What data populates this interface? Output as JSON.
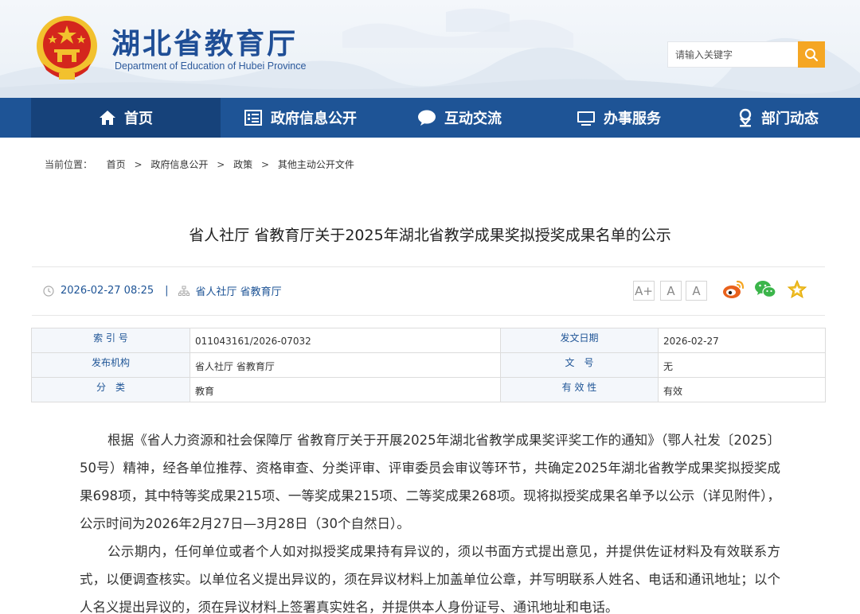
{
  "header": {
    "site_title": "湖北省教育厅",
    "site_subtitle": "Department of Education of Hubei Province",
    "search_placeholder": "请输入关键字"
  },
  "nav": {
    "items": [
      {
        "label": "首页",
        "icon": "home-icon"
      },
      {
        "label": "政府信息公开",
        "icon": "document-list-icon"
      },
      {
        "label": "互动交流",
        "icon": "chat-bubble-icon"
      },
      {
        "label": "办事服务",
        "icon": "monitor-icon"
      },
      {
        "label": "部门动态",
        "icon": "person-pin-icon"
      }
    ]
  },
  "breadcrumb": {
    "prefix": "当前位置：",
    "items": [
      "首页",
      "政府信息公开",
      "政策",
      "其他主动公开文件"
    ],
    "separator": ">"
  },
  "article": {
    "title": "省人社厅 省教育厅关于2025年湖北省教学成果奖拟授奖成果名单的公示",
    "datetime": "2026-02-27 08:25",
    "divider": "|",
    "source": "省人社厅 省教育厅",
    "font_buttons": [
      "A+",
      "A",
      "A"
    ],
    "share_icons": [
      "weibo-icon",
      "wechat-icon",
      "favorite-star-icon"
    ]
  },
  "info_table": {
    "rows": [
      {
        "label1": "索 引 号",
        "value1": "011043161/2026-07032",
        "label2": "发文日期",
        "value2": "2026-02-27"
      },
      {
        "label1": "发布机构",
        "value1": "省人社厅 省教育厅",
        "label2": "文　号",
        "value2": "无"
      },
      {
        "label1": "分　类",
        "value1": "教育",
        "label2": "有 效 性",
        "value2": "有效"
      }
    ]
  },
  "body": {
    "paragraphs": [
      "根据《省人力资源和社会保障厅 省教育厅关于开展2025年湖北省教学成果奖评奖工作的通知》（鄂人社发〔2025〕50号）精神，经各单位推荐、资格审查、分类评审、评审委员会审议等环节，共确定2025年湖北省教学成果奖拟授奖成果698项，其中特等奖成果215项、一等奖成果215项、二等奖成果268项。现将拟授奖成果名单予以公示（详见附件），公示时间为2026年2月27日—3月28日（30个自然日）。",
      "公示期内，任何单位或者个人如对拟授奖成果持有异议的，须以书面方式提出意见，并提供佐证材料及有效联系方式，以便调查核实。以单位名义提出异议的，须在异议材料上加盖单位公章，并写明联系人姓名、电话和通讯地址；以个人名义提出异议的，须在异议材料上签署真实姓名，并提供本人身份证号、通讯地址和电话。"
    ]
  },
  "colors": {
    "brand_blue": "#1e5496",
    "nav_active": "#16427a",
    "search_button": "#f5a623",
    "emblem_red": "#d4261d",
    "emblem_gold": "#f2c12e"
  }
}
